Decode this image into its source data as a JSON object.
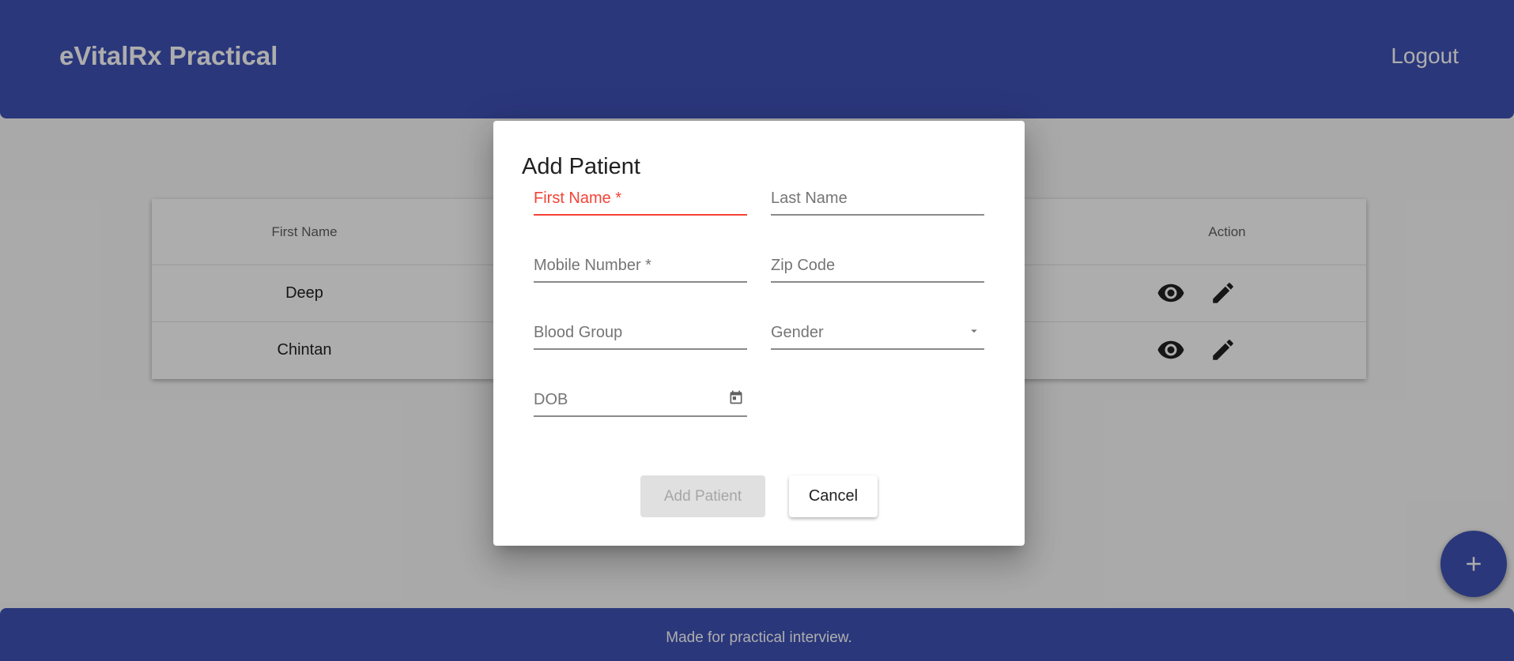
{
  "header": {
    "title": "eVitalRx Practical",
    "logout_label": "Logout"
  },
  "table": {
    "columns": {
      "first_name": "First Name",
      "action": "Action"
    },
    "rows": [
      {
        "first_name": "Deep",
        "actions": [
          "eye-icon",
          "pencil-icon"
        ]
      },
      {
        "first_name": "Chintan",
        "actions": [
          "eye-icon",
          "pencil-icon"
        ]
      }
    ]
  },
  "footer": {
    "text": "Made for practical interview."
  },
  "fab": {
    "icon": "plus-icon",
    "label": "+"
  },
  "dialog": {
    "title": "Add Patient",
    "fields": {
      "first_name": "First Name *",
      "last_name": "Last Name",
      "mobile": "Mobile Number *",
      "zip": "Zip Code",
      "blood_group": "Blood Group",
      "gender": "Gender",
      "dob": "DOB"
    },
    "add_label": "Add Patient",
    "cancel_label": "Cancel"
  },
  "colors": {
    "primary": "#3f51b5",
    "error": "#f44336"
  }
}
